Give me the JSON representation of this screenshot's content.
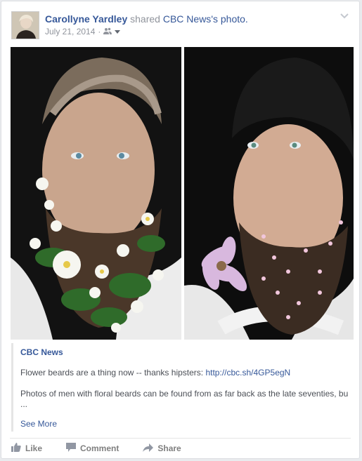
{
  "post": {
    "author_name": "Carollyne Yardley",
    "shared_text": " shared ",
    "page_name": "CBC News",
    "page_suffix": "'s photo.",
    "date": "July 21, 2014",
    "separator": "·",
    "icons": {
      "audience": "friends-icon",
      "audience_dropdown": "caret-down-icon",
      "options": "chevron-down-icon"
    }
  },
  "link_preview": {
    "title": "CBC News",
    "line1_text": "Flower beards are a thing now -- thanks hipsters: ",
    "line1_url": "http://cbc.sh/4GP5egN",
    "line2": "Photos of men with floral beards can be found from as far back as the late seventies, bu",
    "line2_ellipsis": "...",
    "see_more": "See More"
  },
  "actions": {
    "like": "Like",
    "comment": "Comment",
    "share": "Share",
    "icons": [
      "thumbs-up-icon",
      "comment-bubble-icon",
      "share-arrow-icon"
    ]
  },
  "colors": {
    "link_blue": "#365899",
    "muted_grey": "#90949c",
    "action_grey": "#7f7f7f",
    "border": "#dddfe2"
  }
}
